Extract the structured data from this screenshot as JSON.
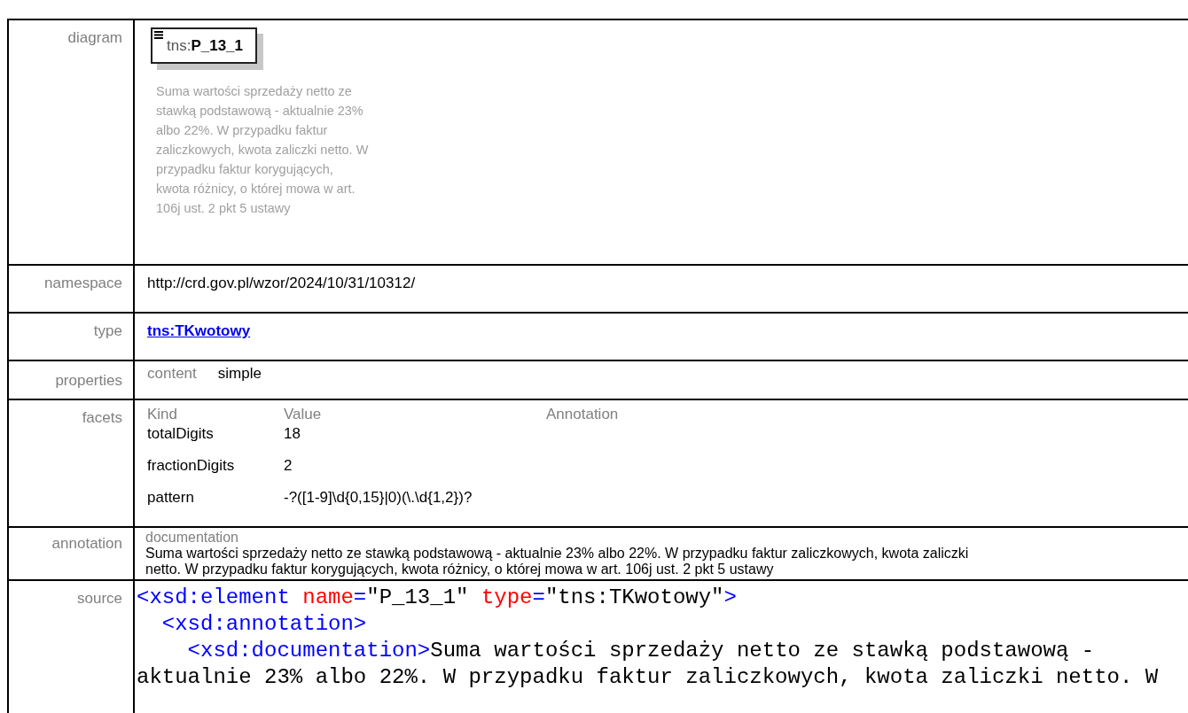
{
  "diagram": {
    "label": "diagram",
    "prefix": "tns:",
    "name": "P_13_1",
    "description": "Suma wartości sprzedaży netto ze stawką podstawową - aktualnie 23% albo 22%. W przypadku faktur zaliczkowych, kwota zaliczki netto. W przypadku faktur korygujących, kwota różnicy, o której mowa w art. 106j ust. 2 pkt 5 ustawy"
  },
  "namespace": {
    "label": "namespace",
    "value": "http://crd.gov.pl/wzor/2024/10/31/10312/"
  },
  "type": {
    "label": "type",
    "value": "tns:TKwotowy"
  },
  "properties": {
    "label": "properties",
    "items": [
      {
        "key": "content",
        "value": "simple"
      }
    ]
  },
  "facets": {
    "label": "facets",
    "columns": [
      "Kind",
      "Value",
      "Annotation"
    ],
    "rows": [
      {
        "kind": "totalDigits",
        "value": "18"
      },
      {
        "kind": "fractionDigits",
        "value": "2"
      },
      {
        "kind": "pattern",
        "value": "-?([1-9]\\d{0,15}|0)(\\.\\d{1,2})?"
      }
    ]
  },
  "annotation": {
    "label": "annotation",
    "heading": "documentation",
    "text": "Suma wartości sprzedaży netto ze stawką podstawową - aktualnie 23% albo 22%. W przypadku faktur zaliczkowych, kwota zaliczki netto. W przypadku faktur korygujących, kwota różnicy, o której mowa w art. 106j ust. 2 pkt 5 ustawy"
  },
  "source": {
    "label": "source",
    "lines": [
      [
        {
          "kind": "tag",
          "text": "<xsd:element "
        },
        {
          "kind": "attr",
          "text": "name"
        },
        {
          "kind": "tag",
          "text": "="
        },
        {
          "kind": "value",
          "text": "\"P_13_1\" "
        },
        {
          "kind": "attr",
          "text": "type"
        },
        {
          "kind": "tag",
          "text": "="
        },
        {
          "kind": "value",
          "text": "\"tns:TKwotowy\""
        },
        {
          "kind": "tag",
          "text": ">"
        }
      ],
      [
        {
          "kind": "tag",
          "text": "  <xsd:annotation>"
        }
      ],
      [
        {
          "kind": "tag",
          "text": "    <xsd:documentation>"
        },
        {
          "kind": "text",
          "text": "Suma wartości sprzedaży netto ze stawką podstawową -"
        }
      ],
      [
        {
          "kind": "text",
          "text": "aktualnie 23% albo 22%. W przypadku faktur zaliczkowych, kwota zaliczki netto. W"
        }
      ]
    ]
  }
}
